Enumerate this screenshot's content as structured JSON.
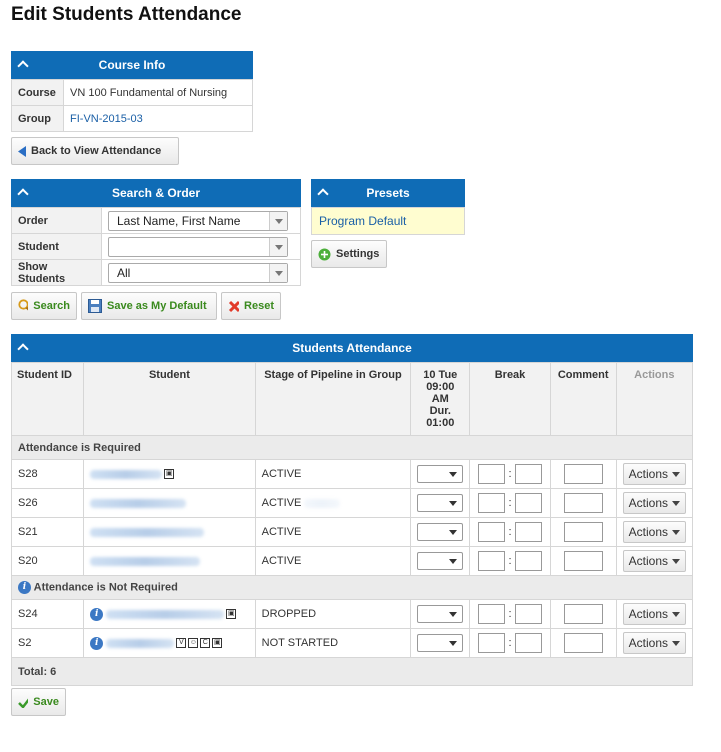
{
  "page_title": "Edit Students Attendance",
  "course_info": {
    "title": "Course Info",
    "rows": [
      {
        "label": "Course",
        "value": "VN 100 Fundamental of Nursing"
      },
      {
        "label": "Group",
        "value": "FI-VN-2015-03"
      }
    ]
  },
  "back_button": "Back to View Attendance",
  "search_order": {
    "title": "Search & Order",
    "order_label": "Order",
    "order_value": "Last Name, First Name",
    "student_label": "Student",
    "student_value": "",
    "show_label": "Show Students",
    "show_value": "All"
  },
  "presets": {
    "title": "Presets",
    "item": "Program Default",
    "settings_label": "Settings"
  },
  "toolbar": {
    "search": "Search",
    "save_default": "Save as My Default",
    "reset": "Reset"
  },
  "attendance": {
    "title": "Students Attendance",
    "columns": {
      "student_id": "Student ID",
      "student": "Student",
      "stage": "Stage of Pipeline in Group",
      "session_l1": "10 Tue",
      "session_l2": "09:00",
      "session_l3": "AM",
      "session_l4": "Dur.",
      "session_l5": "01:00",
      "break": "Break",
      "comment": "Comment",
      "actions": "Actions"
    },
    "group_required": "Attendance is Required",
    "group_not_required": "Attendance is Not Required",
    "required_rows": [
      {
        "id": "S28",
        "stage": "ACTIVE",
        "actions": "Actions"
      },
      {
        "id": "S26",
        "stage": "ACTIVE",
        "actions": "Actions"
      },
      {
        "id": "S21",
        "stage": "ACTIVE",
        "actions": "Actions"
      },
      {
        "id": "S20",
        "stage": "ACTIVE",
        "actions": "Actions"
      }
    ],
    "not_required_rows": [
      {
        "id": "S24",
        "stage": "DROPPED",
        "actions": "Actions"
      },
      {
        "id": "S2",
        "stage": "NOT STARTED",
        "actions": "Actions"
      }
    ],
    "total": "Total: 6",
    "break_sep": ":",
    "badges_s2": [
      "V",
      "C"
    ]
  },
  "save_button": "Save",
  "colors": {
    "header_blue": "#0f6cb6",
    "link": "#1a5fa6",
    "preset_bg": "#fffdd0",
    "green_text": "#3a8a1e"
  }
}
